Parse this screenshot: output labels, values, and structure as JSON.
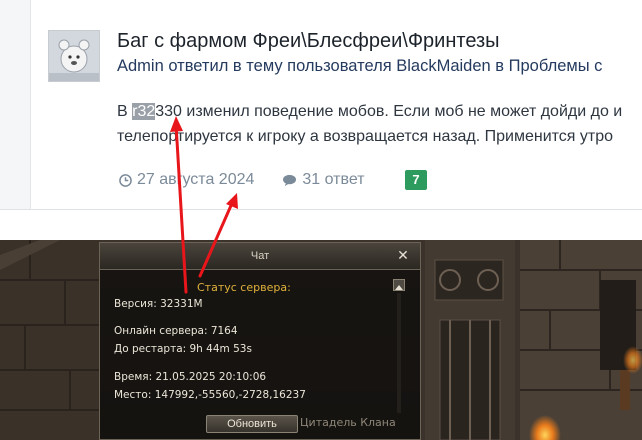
{
  "post": {
    "title": "Баг с фармом Фреи\\Блесфреи\\Фринтезы",
    "meta": "Admin ответил в тему пользователя BlackMaiden в Проблемы с",
    "body_line1_pre": "В ",
    "body_line1_highlight": "r32",
    "body_line1_post": "330 изменил поведение мобов. Если моб не может дойди до и",
    "body_line2": "телепортируется к игроку а возвращается назад. Применится утро",
    "date": "27 августа 2024",
    "replies": "31 ответ",
    "reply_badge": "7",
    "icons": {
      "date": "clock-icon",
      "replies": "comment-icon"
    }
  },
  "chat": {
    "title": "Чат",
    "close": "✕",
    "status_title": "Статус сервера:",
    "version": "Версия: 32331M",
    "online": "Онлайн сервера:  7164",
    "restart": "До рестарта: 9h 44m 53s",
    "time": "Время: 21.05.2025 20:10:06",
    "place": "Место: 147992,-55560,-2728,16237",
    "refresh_label": "Обновить"
  },
  "background_text": "Цитадель Клана",
  "colors": {
    "accent_green": "#2d9b5e",
    "status_gold": "#e0b23c",
    "annotation_red": "#e8161b"
  }
}
